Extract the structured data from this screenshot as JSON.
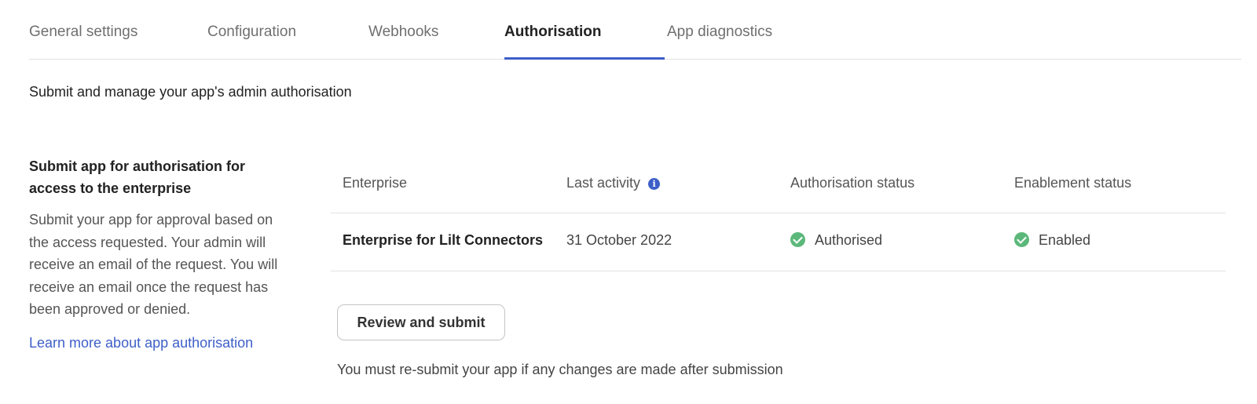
{
  "tabs": [
    {
      "label": "General settings",
      "active": false
    },
    {
      "label": "Configuration",
      "active": false
    },
    {
      "label": "Webhooks",
      "active": false
    },
    {
      "label": "Authorisation",
      "active": true
    },
    {
      "label": "App diagnostics",
      "active": false
    }
  ],
  "colors": {
    "accent": "#3e5fc8",
    "success": "#5cb87a",
    "border": "#e2e2e2"
  },
  "page": {
    "subtitle": "Submit and manage your app's admin authorisation"
  },
  "left": {
    "heading": "Submit app for authorisation for access to the enterprise",
    "description": "Submit your app for approval based on the access requested. Your admin will receive an email of the request. You will receive an email once the request has been approved or denied.",
    "link": "Learn more about app authorisation"
  },
  "table": {
    "headers": {
      "enterprise": "Enterprise",
      "last_activity": "Last activity",
      "auth_status": "Authorisation status",
      "enable_status": "Enablement status"
    },
    "info_icon": "info-icon",
    "row": {
      "enterprise": "Enterprise for Lilt Connectors",
      "last_activity": "31 October 2022",
      "auth_status": "Authorised",
      "auth_icon": "check-circle-icon",
      "enable_status": "Enabled",
      "enable_icon": "check-circle-icon"
    }
  },
  "actions": {
    "review_button": "Review and submit",
    "note": "You must re-submit your app if any changes are made after submission"
  }
}
